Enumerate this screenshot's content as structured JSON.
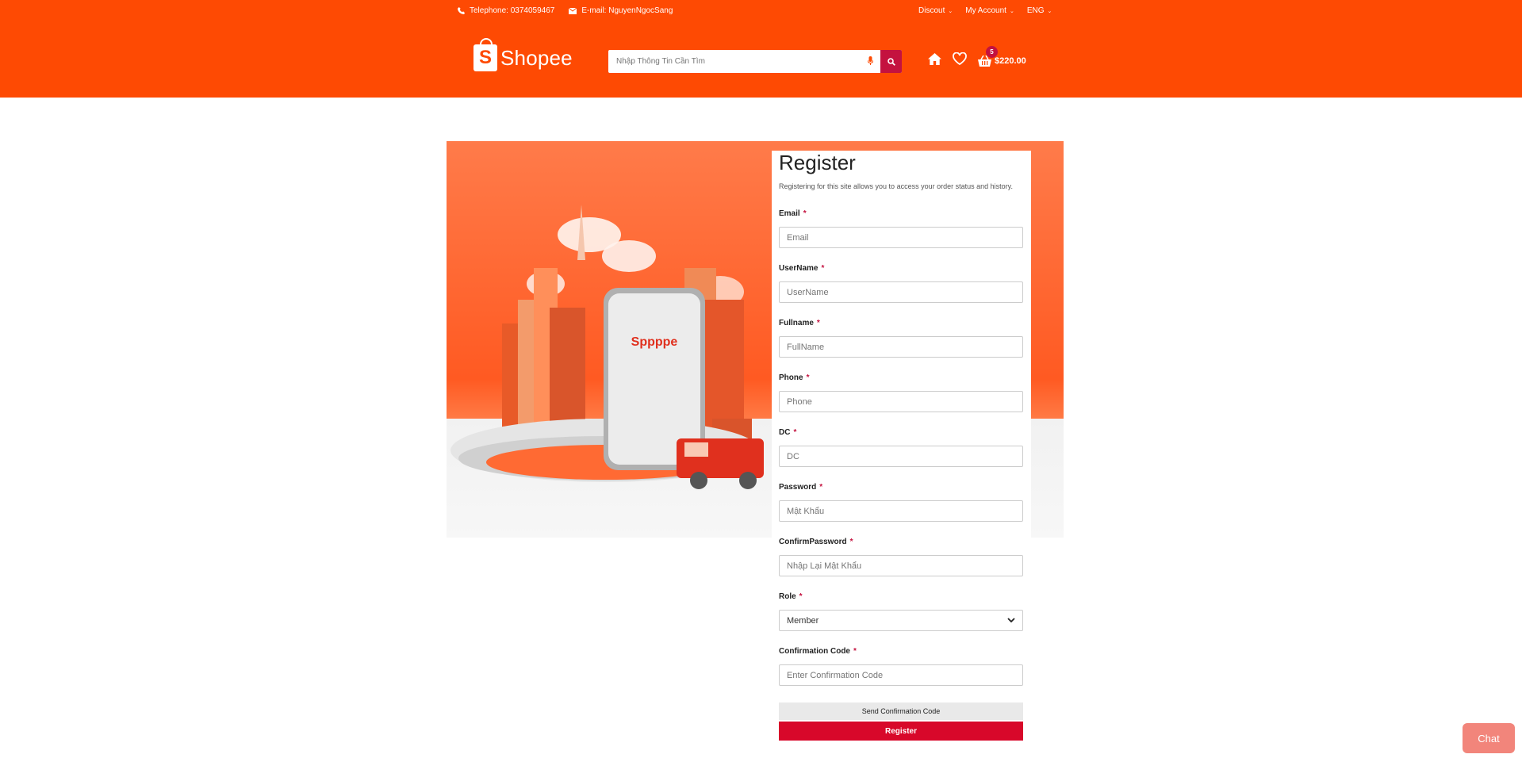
{
  "topbar": {
    "telephone": "Telephone: 0374059467",
    "email": "E-mail: NguyenNgocSang",
    "discout": "Discout",
    "my_account": "My Account",
    "language": "ENG"
  },
  "header": {
    "logo_text": "Shopee",
    "logo_letter": "S",
    "search_placeholder": "Nhập Thông Tin Cần Tìm",
    "cart_count": "5",
    "cart_total": "$220.00"
  },
  "hero": {
    "phone_brand": "Sppppe"
  },
  "register": {
    "title": "Register",
    "subtitle": "Registering for this site allows you to access your order status and history.",
    "fields": [
      {
        "label": "Email",
        "placeholder": "Email"
      },
      {
        "label": "UserName",
        "placeholder": "UserName"
      },
      {
        "label": "Fullname",
        "placeholder": "FullName"
      },
      {
        "label": "Phone",
        "placeholder": "Phone"
      },
      {
        "label": "DC",
        "placeholder": "DC"
      },
      {
        "label": "Password",
        "placeholder": "Mật Khẩu"
      },
      {
        "label": "ConfirmPassword",
        "placeholder": "Nhập Lại Mật Khẩu"
      },
      {
        "label": "Role",
        "value": "Member"
      },
      {
        "label": "Confirmation Code",
        "placeholder": "Enter Confirmation Code"
      }
    ],
    "required_mark": "*",
    "send_code_label": "Send Confirmation Code",
    "register_label": "Register"
  },
  "chat": {
    "label": "Chat"
  },
  "colors": {
    "brand": "#fe4a03",
    "accent": "#d8082a"
  }
}
